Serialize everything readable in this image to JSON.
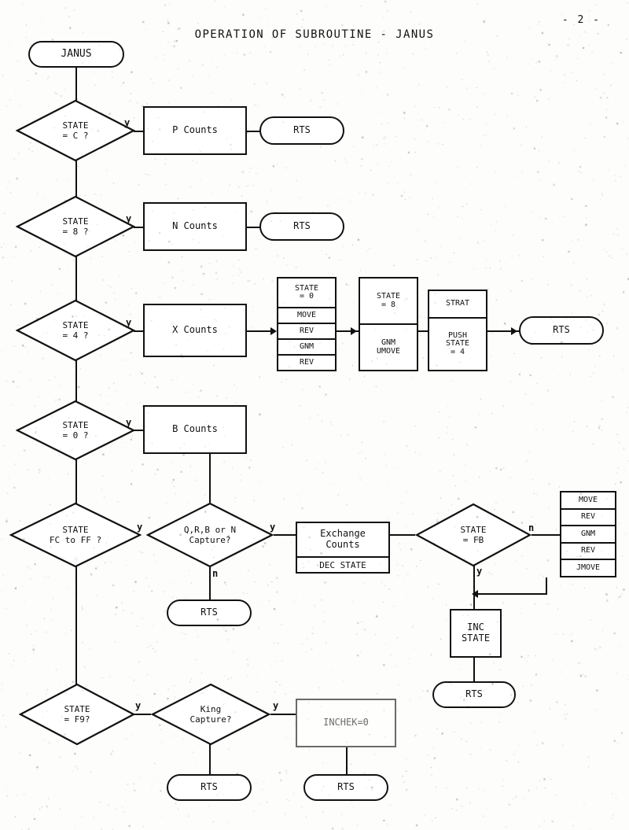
{
  "page": {
    "title": "OPERATION OF SUBROUTINE - JANUS",
    "page_number": "- 2 -"
  },
  "nodes": {
    "start": "JANUS",
    "d1": {
      "line1": "STATE",
      "line2": "= C ?"
    },
    "d2": {
      "line1": "STATE",
      "line2": "= 8 ?"
    },
    "d3": {
      "line1": "STATE",
      "line2": "= 4 ?"
    },
    "d4": {
      "line1": "STATE",
      "line2": "= 0 ?"
    },
    "d5": {
      "line1": "STATE",
      "line2": "FC to FF ?"
    },
    "d6": {
      "line1": "Q,R,B or N",
      "line2": "Capture?"
    },
    "d7": {
      "line1": "STATE",
      "line2": "= FB"
    },
    "d8": {
      "line1": "STATE",
      "line2": "= F9?"
    },
    "d9": {
      "line1": "King",
      "line2": "Capture?"
    },
    "p_counts": "P Counts",
    "n_counts": "N Counts",
    "x_counts": "X Counts",
    "b_counts": "B Counts",
    "exchange": {
      "line1": "Exchange",
      "line2": "Counts",
      "sub": "DEC STATE"
    },
    "inc_state": {
      "line1": "INC",
      "line2": "STATE"
    },
    "inchek": "INCHEK=0",
    "rts1": "RTS",
    "rts2": "RTS",
    "rts3": "RTS",
    "rts4": "RTS",
    "rts5": "RTS",
    "rts6": "RTS",
    "rts7": "RTS"
  },
  "stacks": {
    "stack1": {
      "cells": [
        "STATE",
        "= 0",
        "MOVE",
        "REV",
        "GNM",
        "REV"
      ]
    },
    "stack2": {
      "cells": [
        "STATE",
        "= 8",
        "GNM",
        "UMOVE"
      ]
    },
    "stack3": {
      "cells": [
        "STRAT",
        "PUSH",
        "STATE",
        "= 4"
      ]
    },
    "stack4": {
      "cells": [
        "MOVE",
        "REV",
        "GNM",
        "REV",
        "JMOVE"
      ]
    }
  },
  "edge_labels": {
    "y1": "y",
    "y2": "y",
    "y3": "y",
    "y4": "y",
    "y5": "y",
    "y6": "y",
    "y7": "y",
    "y8": "y",
    "y9": "y",
    "n1": "n",
    "n2": "n"
  },
  "colors": {
    "ink": "#111111",
    "paper": "#fdfdfb"
  }
}
